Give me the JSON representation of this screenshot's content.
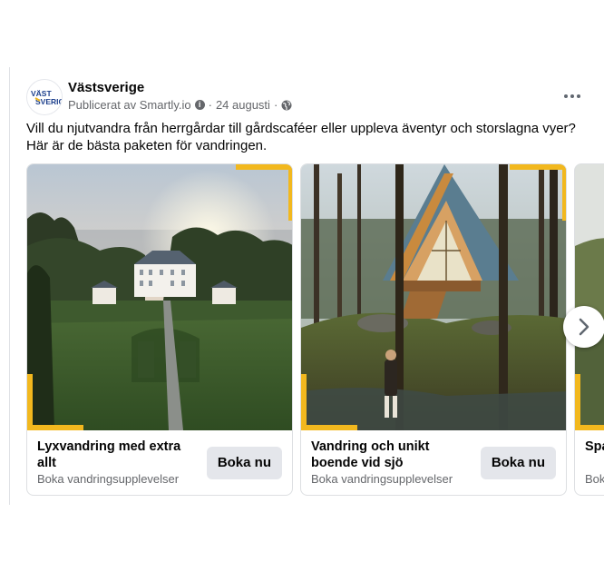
{
  "post": {
    "page_name": "Västsverige",
    "logo_text": "VÄST SVERIGE",
    "author_line": "Publicerat av Smartly.io",
    "date": "24 augusti",
    "separator": "·",
    "text_line1": "Vill du njutvandra från herrgårdar till gårdscaféer eller uppleva äventyr och storslagna vyer?",
    "text_line2": "Här är de bästa paketen för vandringen."
  },
  "cards": [
    {
      "title": "Lyxvandring med extra allt",
      "subtitle": "Boka vandringsupplevelser",
      "cta": "Boka nu",
      "image": "manor-aerial-sunset"
    },
    {
      "title": "Vandring och unikt boende vid sjö",
      "subtitle": "Boka vandringsupplevelser",
      "cta": "Boka nu",
      "image": "a-frame-cabin-forest"
    },
    {
      "title": "Spa vid",
      "subtitle": "Bok",
      "cta": "",
      "image": "partial-card"
    }
  ],
  "colors": {
    "accent_frame": "#f2b81e",
    "cta_bg": "#e4e6eb",
    "meta_text": "#65676b"
  },
  "icons": {
    "info": "info-icon",
    "globe": "globe-icon",
    "more": "more-options-icon",
    "next": "chevron-right-icon"
  }
}
